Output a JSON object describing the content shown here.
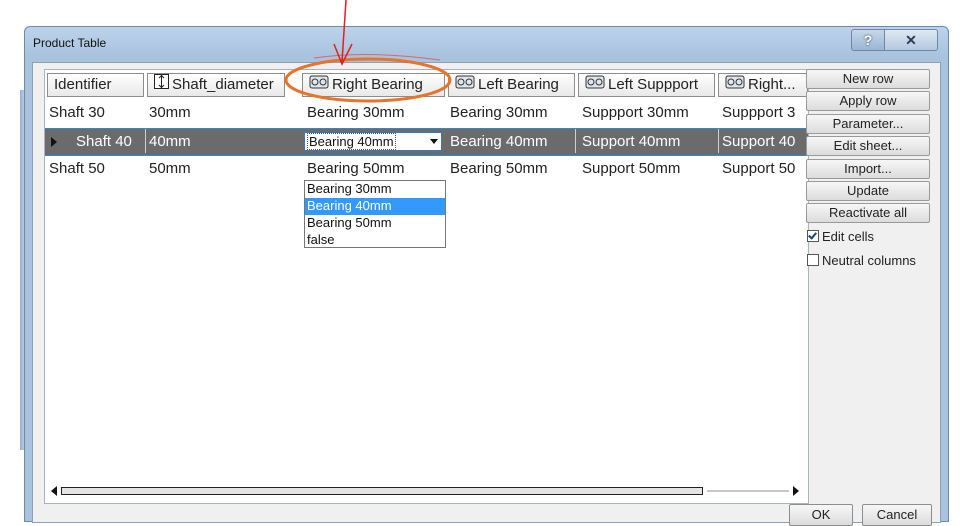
{
  "window": {
    "title": "Product Table",
    "help_label": "?",
    "close_label": "✕"
  },
  "table": {
    "columns": [
      {
        "label": "Identifier",
        "icon": ""
      },
      {
        "label": "Shaft_diameter",
        "icon": "dimension-icon"
      },
      {
        "label": "Right Bearing",
        "icon": "part-icon"
      },
      {
        "label": "Left Bearing",
        "icon": "part-icon"
      },
      {
        "label": "Left Suppport",
        "icon": "part-icon"
      },
      {
        "label": "Right...",
        "icon": "part-icon"
      }
    ],
    "rows": [
      {
        "id": "Shaft 30",
        "diameter": "30mm",
        "right_bearing": "Bearing 30mm",
        "left_bearing": "Bearing 30mm",
        "left_support": "Suppport 30mm",
        "right_support": "Suppport 3"
      },
      {
        "id": "Shaft 40",
        "diameter": "40mm",
        "right_bearing": "Bearing 40mm",
        "left_bearing": "Bearing 40mm",
        "left_support": "Support 40mm",
        "right_support": "Support 40",
        "selected": true
      },
      {
        "id": "Shaft 50",
        "diameter": "50mm",
        "right_bearing": "Bearing 50mm",
        "left_bearing": "Bearing 50mm",
        "left_support": "Support 50mm",
        "right_support": "Support 50"
      }
    ],
    "dropdown": {
      "value": "Bearing 40mm",
      "options": [
        "Bearing 30mm",
        "Bearing 40mm",
        "Bearing 50mm",
        "false"
      ],
      "highlighted": "Bearing 40mm"
    }
  },
  "side_buttons": [
    "New row",
    "Apply row",
    "Parameter...",
    "Edit sheet...",
    "Import...",
    "Update",
    "Reactivate all"
  ],
  "options": {
    "edit_cells": {
      "label": "Edit cells",
      "checked": true
    },
    "neutral_columns": {
      "label": "Neutral columns",
      "checked": false
    }
  },
  "footer": {
    "ok": "OK",
    "cancel": "Cancel"
  },
  "colors": {
    "highlight": "#3399ff",
    "selected_row": "#6b6b6b",
    "annotation": "#e8732a",
    "arrow": "#e02020"
  }
}
